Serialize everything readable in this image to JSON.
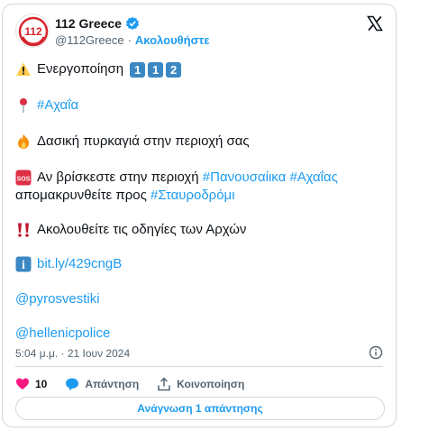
{
  "author": {
    "name": "112 Greece",
    "handle": "@112Greece",
    "separator": "·",
    "follow_label": "Ακολουθήστε",
    "avatar_text": "112"
  },
  "tweet": {
    "line1": {
      "text": "Ενεργοποίηση",
      "icon": "warning-icon",
      "keycaps": [
        "1",
        "1",
        "2"
      ]
    },
    "line2": {
      "hashtag": "#Αχαΐα",
      "icon": "pin-icon"
    },
    "line3": {
      "text": "Δασική πυρκαγιά στην περιοχή σας",
      "icon": "fire-icon"
    },
    "line4": {
      "text": "Αν βρίσκεστε στην περιοχή ",
      "hashtag1": "#Πανουσαίικα",
      "hashtag2": "#Αχαΐας",
      "icon": "sos-icon",
      "sos_text": "SOS"
    },
    "line5": {
      "text": "απομακρυνθείτε προς ",
      "hashtag": "#Σταυροδρόμι"
    },
    "line6": {
      "text": "Ακολουθείτε τις οδηγίες των Αρχών",
      "icon": "double-exclamation-icon"
    },
    "line7": {
      "link": "bit.ly/429cngB",
      "icon": "info-icon",
      "icon_text": "i"
    },
    "line8": {
      "mention": "@pyrosvestiki"
    },
    "line9": {
      "mention": "@hellenicpolice"
    }
  },
  "meta": {
    "timestamp": "5:04 μ.μ. · 21 Ιουν 2024"
  },
  "actions": {
    "likes": "10",
    "reply_label": "Απάντηση",
    "share_label": "Κοινοποίηση"
  },
  "read_replies_label": "Ανάγνωση 1 απάντησης",
  "colors": {
    "accent": "#1d9bf0",
    "like": "#f91880",
    "brand_red": "#d7262e"
  }
}
